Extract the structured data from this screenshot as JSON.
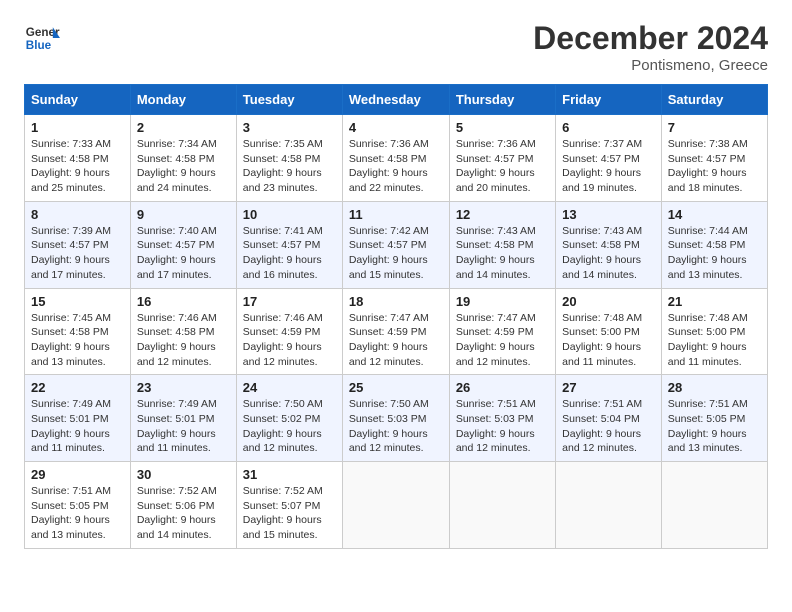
{
  "header": {
    "logo_line1": "General",
    "logo_line2": "Blue",
    "month": "December 2024",
    "location": "Pontismeno, Greece"
  },
  "weekdays": [
    "Sunday",
    "Monday",
    "Tuesday",
    "Wednesday",
    "Thursday",
    "Friday",
    "Saturday"
  ],
  "weeks": [
    [
      {
        "day": "1",
        "sunrise": "7:33 AM",
        "sunset": "4:58 PM",
        "daylight": "9 hours and 25 minutes."
      },
      {
        "day": "2",
        "sunrise": "7:34 AM",
        "sunset": "4:58 PM",
        "daylight": "9 hours and 24 minutes."
      },
      {
        "day": "3",
        "sunrise": "7:35 AM",
        "sunset": "4:58 PM",
        "daylight": "9 hours and 23 minutes."
      },
      {
        "day": "4",
        "sunrise": "7:36 AM",
        "sunset": "4:58 PM",
        "daylight": "9 hours and 22 minutes."
      },
      {
        "day": "5",
        "sunrise": "7:36 AM",
        "sunset": "4:57 PM",
        "daylight": "9 hours and 20 minutes."
      },
      {
        "day": "6",
        "sunrise": "7:37 AM",
        "sunset": "4:57 PM",
        "daylight": "9 hours and 19 minutes."
      },
      {
        "day": "7",
        "sunrise": "7:38 AM",
        "sunset": "4:57 PM",
        "daylight": "9 hours and 18 minutes."
      }
    ],
    [
      {
        "day": "8",
        "sunrise": "7:39 AM",
        "sunset": "4:57 PM",
        "daylight": "9 hours and 17 minutes."
      },
      {
        "day": "9",
        "sunrise": "7:40 AM",
        "sunset": "4:57 PM",
        "daylight": "9 hours and 17 minutes."
      },
      {
        "day": "10",
        "sunrise": "7:41 AM",
        "sunset": "4:57 PM",
        "daylight": "9 hours and 16 minutes."
      },
      {
        "day": "11",
        "sunrise": "7:42 AM",
        "sunset": "4:57 PM",
        "daylight": "9 hours and 15 minutes."
      },
      {
        "day": "12",
        "sunrise": "7:43 AM",
        "sunset": "4:58 PM",
        "daylight": "9 hours and 14 minutes."
      },
      {
        "day": "13",
        "sunrise": "7:43 AM",
        "sunset": "4:58 PM",
        "daylight": "9 hours and 14 minutes."
      },
      {
        "day": "14",
        "sunrise": "7:44 AM",
        "sunset": "4:58 PM",
        "daylight": "9 hours and 13 minutes."
      }
    ],
    [
      {
        "day": "15",
        "sunrise": "7:45 AM",
        "sunset": "4:58 PM",
        "daylight": "9 hours and 13 minutes."
      },
      {
        "day": "16",
        "sunrise": "7:46 AM",
        "sunset": "4:58 PM",
        "daylight": "9 hours and 12 minutes."
      },
      {
        "day": "17",
        "sunrise": "7:46 AM",
        "sunset": "4:59 PM",
        "daylight": "9 hours and 12 minutes."
      },
      {
        "day": "18",
        "sunrise": "7:47 AM",
        "sunset": "4:59 PM",
        "daylight": "9 hours and 12 minutes."
      },
      {
        "day": "19",
        "sunrise": "7:47 AM",
        "sunset": "4:59 PM",
        "daylight": "9 hours and 12 minutes."
      },
      {
        "day": "20",
        "sunrise": "7:48 AM",
        "sunset": "5:00 PM",
        "daylight": "9 hours and 11 minutes."
      },
      {
        "day": "21",
        "sunrise": "7:48 AM",
        "sunset": "5:00 PM",
        "daylight": "9 hours and 11 minutes."
      }
    ],
    [
      {
        "day": "22",
        "sunrise": "7:49 AM",
        "sunset": "5:01 PM",
        "daylight": "9 hours and 11 minutes."
      },
      {
        "day": "23",
        "sunrise": "7:49 AM",
        "sunset": "5:01 PM",
        "daylight": "9 hours and 11 minutes."
      },
      {
        "day": "24",
        "sunrise": "7:50 AM",
        "sunset": "5:02 PM",
        "daylight": "9 hours and 12 minutes."
      },
      {
        "day": "25",
        "sunrise": "7:50 AM",
        "sunset": "5:03 PM",
        "daylight": "9 hours and 12 minutes."
      },
      {
        "day": "26",
        "sunrise": "7:51 AM",
        "sunset": "5:03 PM",
        "daylight": "9 hours and 12 minutes."
      },
      {
        "day": "27",
        "sunrise": "7:51 AM",
        "sunset": "5:04 PM",
        "daylight": "9 hours and 12 minutes."
      },
      {
        "day": "28",
        "sunrise": "7:51 AM",
        "sunset": "5:05 PM",
        "daylight": "9 hours and 13 minutes."
      }
    ],
    [
      {
        "day": "29",
        "sunrise": "7:51 AM",
        "sunset": "5:05 PM",
        "daylight": "9 hours and 13 minutes."
      },
      {
        "day": "30",
        "sunrise": "7:52 AM",
        "sunset": "5:06 PM",
        "daylight": "9 hours and 14 minutes."
      },
      {
        "day": "31",
        "sunrise": "7:52 AM",
        "sunset": "5:07 PM",
        "daylight": "9 hours and 15 minutes."
      },
      null,
      null,
      null,
      null
    ]
  ]
}
